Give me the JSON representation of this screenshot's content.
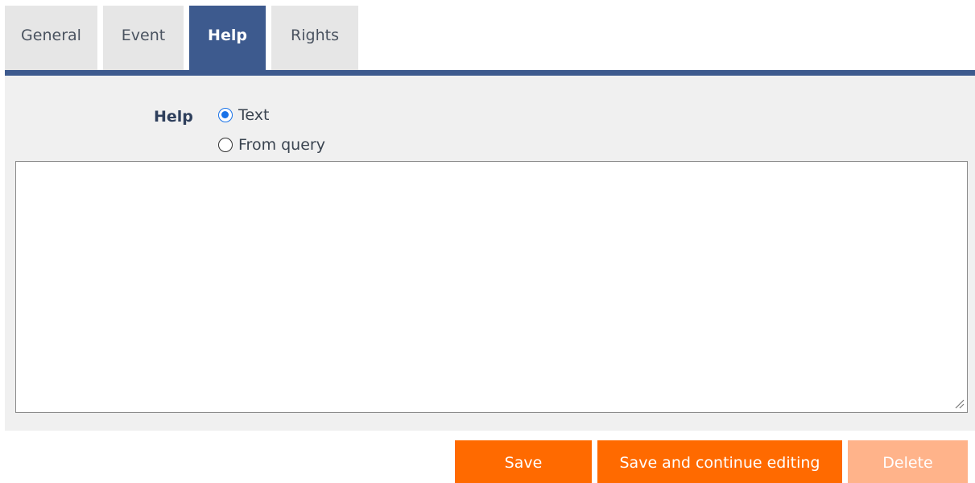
{
  "tabs": [
    {
      "label": "General",
      "active": false
    },
    {
      "label": "Event",
      "active": false
    },
    {
      "label": "Help",
      "active": true
    },
    {
      "label": "Rights",
      "active": false
    }
  ],
  "help": {
    "label": "Help",
    "options": [
      {
        "label": "Text",
        "checked": true
      },
      {
        "label": "From query",
        "checked": false
      }
    ],
    "text_value": ""
  },
  "buttons": {
    "save": "Save",
    "save_continue": "Save and continue editing",
    "delete": "Delete"
  },
  "colors": {
    "tab_active": "#3d5a8e",
    "tab_inactive": "#e6e6e6",
    "primary_button": "#ff6a00",
    "disabled_button": "#ffb38a"
  }
}
